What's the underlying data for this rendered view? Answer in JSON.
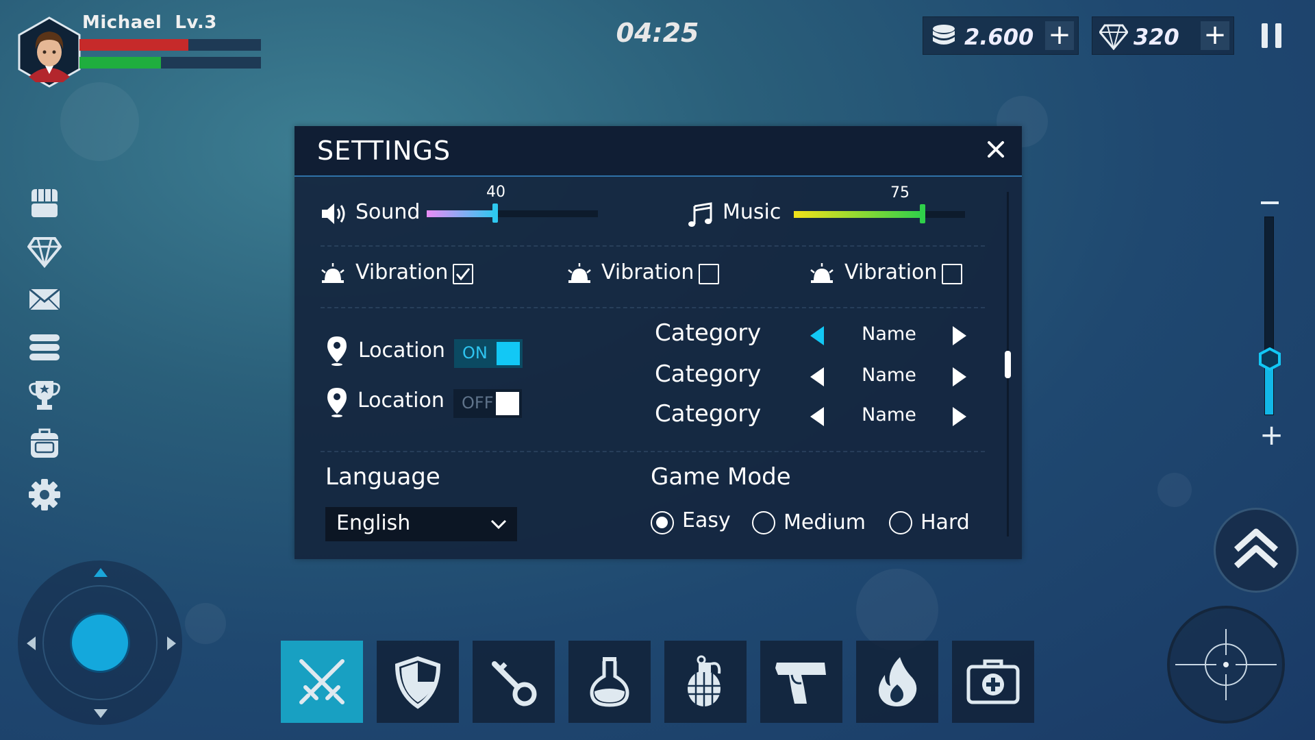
{
  "player": {
    "name": "Michael",
    "level": "Lv.3",
    "hp_fraction": 0.6,
    "xp_fraction": 0.45
  },
  "hud": {
    "timer": "04:25",
    "coins": "2.600",
    "gems": "320",
    "plus_label": "+"
  },
  "sidebar": {
    "items": [
      {
        "icon": "shop-icon"
      },
      {
        "icon": "diamond-icon"
      },
      {
        "icon": "mail-icon"
      },
      {
        "icon": "list-icon"
      },
      {
        "icon": "trophy-icon"
      },
      {
        "icon": "backpack-icon"
      },
      {
        "icon": "gear-icon"
      }
    ]
  },
  "settings": {
    "title": "SETTINGS",
    "sound": {
      "label": "Sound",
      "value": 40,
      "value_text": "40"
    },
    "music": {
      "label": "Music",
      "value": 75,
      "value_text": "75"
    },
    "vibration": [
      {
        "label": "Vibration",
        "checked": true
      },
      {
        "label": "Vibration",
        "checked": false
      },
      {
        "label": "Vibration",
        "checked": false
      }
    ],
    "location": [
      {
        "label": "Location",
        "state": "ON"
      },
      {
        "label": "Location",
        "state": "OFF"
      }
    ],
    "categories": [
      {
        "label": "Category",
        "value": "Name"
      },
      {
        "label": "Category",
        "value": "Name"
      },
      {
        "label": "Category",
        "value": "Name"
      }
    ],
    "language": {
      "label": "Language",
      "selected": "English"
    },
    "game_mode": {
      "label": "Game Mode",
      "options": [
        "Easy",
        "Medium",
        "Hard"
      ],
      "selected": "Easy"
    }
  },
  "zoom": {
    "level_fraction": 0.28,
    "minus": "−",
    "plus": "+"
  },
  "hotbar": {
    "slots": [
      {
        "icon": "crossed-swords-icon",
        "active": true
      },
      {
        "icon": "shield-icon",
        "active": false
      },
      {
        "icon": "key-icon",
        "active": false
      },
      {
        "icon": "potion-flask-icon",
        "active": false
      },
      {
        "icon": "grenade-icon",
        "active": false
      },
      {
        "icon": "pistol-icon",
        "active": false
      },
      {
        "icon": "fire-icon",
        "active": false
      },
      {
        "icon": "medkit-icon",
        "active": false
      }
    ]
  },
  "colors": {
    "accent": "#12c8f5",
    "hp": "#c62a2a",
    "xp": "#1fae3e",
    "sound_gradient": [
      "#e98cf5",
      "#2ec8f0"
    ],
    "music_gradient": [
      "#f3e21a",
      "#2fd04a"
    ]
  }
}
